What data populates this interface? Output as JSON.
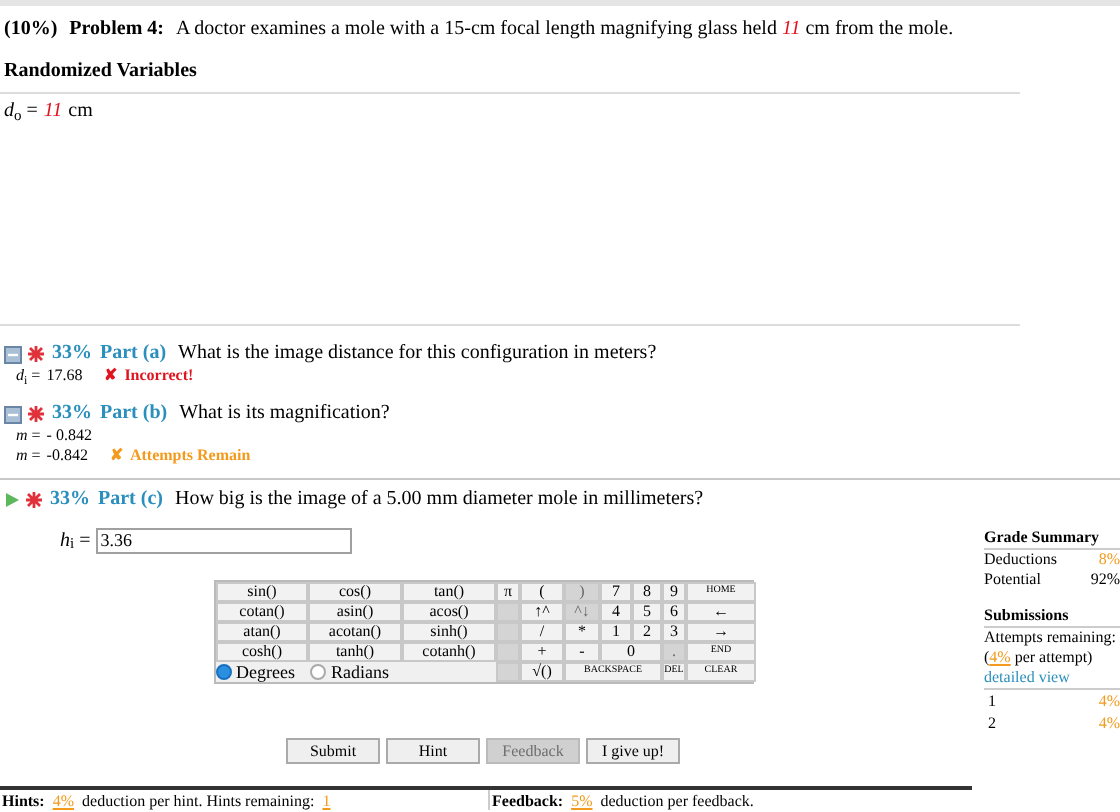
{
  "problem": {
    "weight": "(10%)",
    "label": "Problem 4:",
    "text_before": "A doctor examines a mole with a 15-cm focal length magnifying glass held ",
    "value": "11",
    "text_after": " cm from the mole."
  },
  "randomized": {
    "title": "Randomized Variables",
    "lhs": "*d*$_{o}$ =",
    "value": "11",
    "unit": "cm"
  },
  "parts": [
    {
      "kind": "answered",
      "percent": "33%",
      "label": "Part (a)",
      "question": "What is the image distance for this configuration in meters?",
      "answers": [
        {
          "kind": "incorrect",
          "lhs": "*d*$_{i}$ =",
          "value": "17.68",
          "symbol": "✘",
          "status": "Incorrect!"
        }
      ]
    },
    {
      "kind": "answered",
      "percent": "33%",
      "label": "Part (b)",
      "question": "What is its magnification?",
      "answers": [
        {
          "kind": "plain",
          "lhs": "*m* =",
          "value": "- 0.842"
        },
        {
          "kind": "warning",
          "lhs": "*m* =",
          "value": "-0.842",
          "symbol": "✘",
          "status": "Attempts Remain"
        }
      ]
    },
    {
      "kind": "active",
      "percent": "33%",
      "label": "Part (c)",
      "question": "How big is the image of a 5.00 mm diameter mole in millimeters?"
    }
  ],
  "entry": {
    "lhs": "*h*$_{i}$ =",
    "value": "3.36"
  },
  "keypad": {
    "rows": [
      [
        {
          "kind": "key",
          "label": "sin()",
          "disabled": false
        },
        {
          "kind": "key",
          "label": "cos()",
          "disabled": false
        },
        {
          "kind": "key",
          "label": "tan()",
          "disabled": false
        },
        {
          "kind": "key",
          "label": "π",
          "disabled": false
        },
        {
          "kind": "key",
          "label": "(",
          "disabled": false
        },
        {
          "kind": "key",
          "label": ")",
          "disabled": true
        },
        {
          "kind": "key",
          "label": "7",
          "disabled": false
        },
        {
          "kind": "key",
          "label": "8",
          "disabled": false
        },
        {
          "kind": "key",
          "label": "9",
          "disabled": false
        },
        {
          "kind": "key",
          "label": "HOME",
          "disabled": false,
          "small": true
        }
      ],
      [
        {
          "kind": "key",
          "label": "cotan()",
          "disabled": false
        },
        {
          "kind": "key",
          "label": "asin()",
          "disabled": false
        },
        {
          "kind": "key",
          "label": "acos()",
          "disabled": false
        },
        {
          "kind": "blank"
        },
        {
          "kind": "key",
          "label": "↑^",
          "disabled": false
        },
        {
          "kind": "key",
          "label": "^↓",
          "disabled": true
        },
        {
          "kind": "key",
          "label": "4",
          "disabled": false
        },
        {
          "kind": "key",
          "label": "5",
          "disabled": false
        },
        {
          "kind": "key",
          "label": "6",
          "disabled": false
        },
        {
          "kind": "key",
          "label": "←",
          "disabled": false
        }
      ],
      [
        {
          "kind": "key",
          "label": "atan()",
          "disabled": false
        },
        {
          "kind": "key",
          "label": "acotan()",
          "disabled": false
        },
        {
          "kind": "key",
          "label": "sinh()",
          "disabled": false
        },
        {
          "kind": "blank"
        },
        {
          "kind": "key",
          "label": "/",
          "disabled": false
        },
        {
          "kind": "key",
          "label": "*",
          "disabled": false
        },
        {
          "kind": "key",
          "label": "1",
          "disabled": false
        },
        {
          "kind": "key",
          "label": "2",
          "disabled": false
        },
        {
          "kind": "key",
          "label": "3",
          "disabled": false
        },
        {
          "kind": "key",
          "label": "→",
          "disabled": false
        }
      ],
      [
        {
          "kind": "key",
          "label": "cosh()",
          "disabled": false
        },
        {
          "kind": "key",
          "label": "tanh()",
          "disabled": false
        },
        {
          "kind": "key",
          "label": "cotanh()",
          "disabled": false
        },
        {
          "kind": "blank"
        },
        {
          "kind": "key",
          "label": "+",
          "disabled": false
        },
        {
          "kind": "key",
          "label": "-",
          "disabled": false
        },
        {
          "kind": "wide",
          "label": "0",
          "disabled": false
        },
        {
          "kind": "merged"
        },
        {
          "kind": "key",
          "label": ".",
          "disabled": true
        },
        {
          "kind": "key",
          "label": "END",
          "disabled": false,
          "small": true
        }
      ],
      [
        {
          "kind": "radios"
        },
        {
          "kind": "merged"
        },
        {
          "kind": "merged"
        },
        {
          "kind": "blank"
        },
        {
          "kind": "key",
          "label": "√()",
          "disabled": false
        },
        {
          "kind": "long",
          "label": "BACKSPACE",
          "disabled": false,
          "small": true
        },
        {
          "kind": "merged"
        },
        {
          "kind": "merged"
        },
        {
          "kind": "key",
          "label": "DEL",
          "disabled": false,
          "small": true
        },
        {
          "kind": "key",
          "label": "CLEAR",
          "disabled": false,
          "small": true
        }
      ]
    ],
    "radios": [
      {
        "label": "Degrees",
        "selected": true
      },
      {
        "label": "Radians",
        "selected": false
      }
    ]
  },
  "buttons": [
    {
      "label": "Submit",
      "disabled": false
    },
    {
      "label": "Hint",
      "disabled": false
    },
    {
      "label": "Feedback",
      "disabled": true
    },
    {
      "label": "I give up!",
      "disabled": false
    }
  ],
  "grade_summary": {
    "title": "Grade Summary",
    "rows": [
      {
        "label": "Deductions",
        "value": "8%",
        "highlight": true
      },
      {
        "label": "Potential",
        "value": "92%",
        "highlight": false
      }
    ]
  },
  "submissions": {
    "title": "Submissions",
    "attempts_label": "Attempts remaining:",
    "per_attempt_open": "(",
    "per_attempt_value": "4%",
    "per_attempt_close": " per attempt)",
    "link": "detailed view",
    "rows": [
      {
        "label": "1",
        "value": "4%"
      },
      {
        "label": "2",
        "value": "4%"
      }
    ]
  },
  "footer": {
    "hints_label": "Hints:",
    "hints_value": "4%",
    "hints_text": "deduction per hint. Hints remaining:",
    "hints_remaining": "1",
    "feedback_label": "Feedback:",
    "feedback_value": "5%",
    "feedback_text": "deduction per feedback."
  }
}
